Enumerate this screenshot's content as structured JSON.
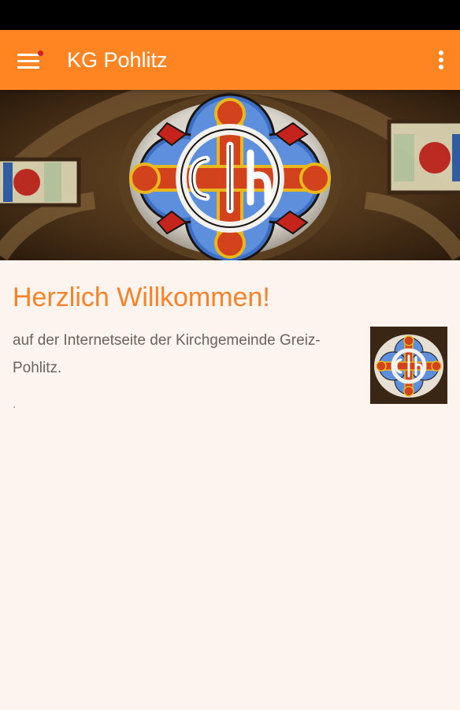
{
  "app_bar": {
    "title": "KG Pohlitz",
    "background_color": "#ff8422",
    "menu_icon": "hamburger-menu-icon",
    "overflow_icon": "more-vert-icon",
    "notification_color": "#d3212a"
  },
  "hero": {
    "image": "stained-glass-window"
  },
  "content": {
    "heading": "Herzlich Willkommen!",
    "heading_color": "#f6822a",
    "text": "auf der Internetseite der Kirchgemeinde Greiz-Pohlitz.",
    "trailing": ".",
    "thumbnail": "stained-glass-thumbnail"
  }
}
